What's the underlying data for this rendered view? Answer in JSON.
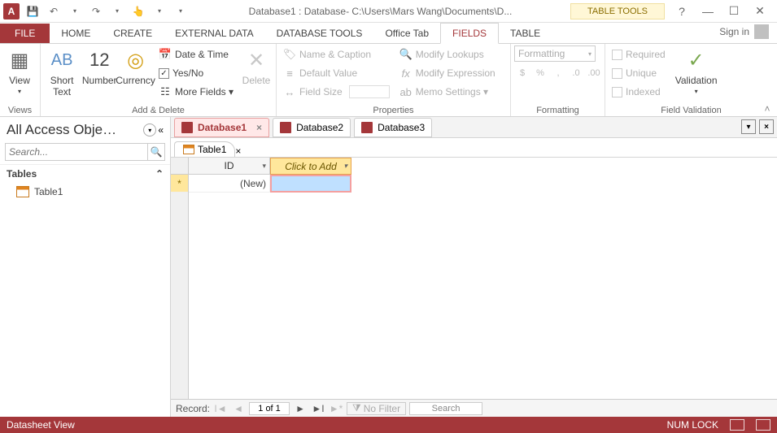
{
  "titlebar": {
    "title": "Database1 : Database- C:\\Users\\Mars Wang\\Documents\\D...",
    "tabtools": "TABLE TOOLS",
    "help_icon": "?",
    "signin": "Sign in"
  },
  "menutabs": {
    "file": "FILE",
    "home": "HOME",
    "create": "CREATE",
    "external": "EXTERNAL DATA",
    "dbtools": "DATABASE TOOLS",
    "officetab": "Office Tab",
    "fields": "FIELDS",
    "table": "TABLE"
  },
  "ribbon": {
    "views": {
      "view": "View",
      "dd": "▾",
      "label": "Views"
    },
    "adddel": {
      "shorttext": "Short Text",
      "number": "Number",
      "currency": "Currency",
      "ab": "AB",
      "twelve": "12",
      "datetime": "Date & Time",
      "yesno": "Yes/No",
      "yesno_checked": "✓",
      "more": "More Fields ▾",
      "delete": "Delete",
      "label": "Add & Delete"
    },
    "props": {
      "namecap": "Name & Caption",
      "default": "Default Value",
      "fieldsize": "Field Size",
      "modlookup": "Modify Lookups",
      "modexpr": "Modify Expression",
      "memoset": "Memo Settings ▾",
      "label": "Properties"
    },
    "fmt": {
      "combo": "Formatting",
      "label": "Formatting"
    },
    "fv": {
      "required": "Required",
      "unique": "Unique",
      "indexed": "Indexed",
      "validation": "Validation",
      "dd": "▾",
      "label": "Field Validation"
    }
  },
  "nav": {
    "title": "All Access Obje…",
    "search_ph": "Search...",
    "section": "Tables",
    "chev": "«",
    "item1": "Table1"
  },
  "objtabs": [
    {
      "label": "Database1",
      "active": true
    },
    {
      "label": "Database2",
      "active": false
    },
    {
      "label": "Database3",
      "active": false
    }
  ],
  "subtab": {
    "label": "Table1"
  },
  "grid": {
    "id_hdr": "ID",
    "add_hdr": "Click to Add",
    "add_dd": "▾",
    "new_marker": "*",
    "new_text": "(New)"
  },
  "recnav": {
    "label": "Record:",
    "pos": "1 of 1",
    "nofilter": "No Filter",
    "search": "Search"
  },
  "status": {
    "view": "Datasheet View",
    "numlock": "NUM LOCK"
  }
}
